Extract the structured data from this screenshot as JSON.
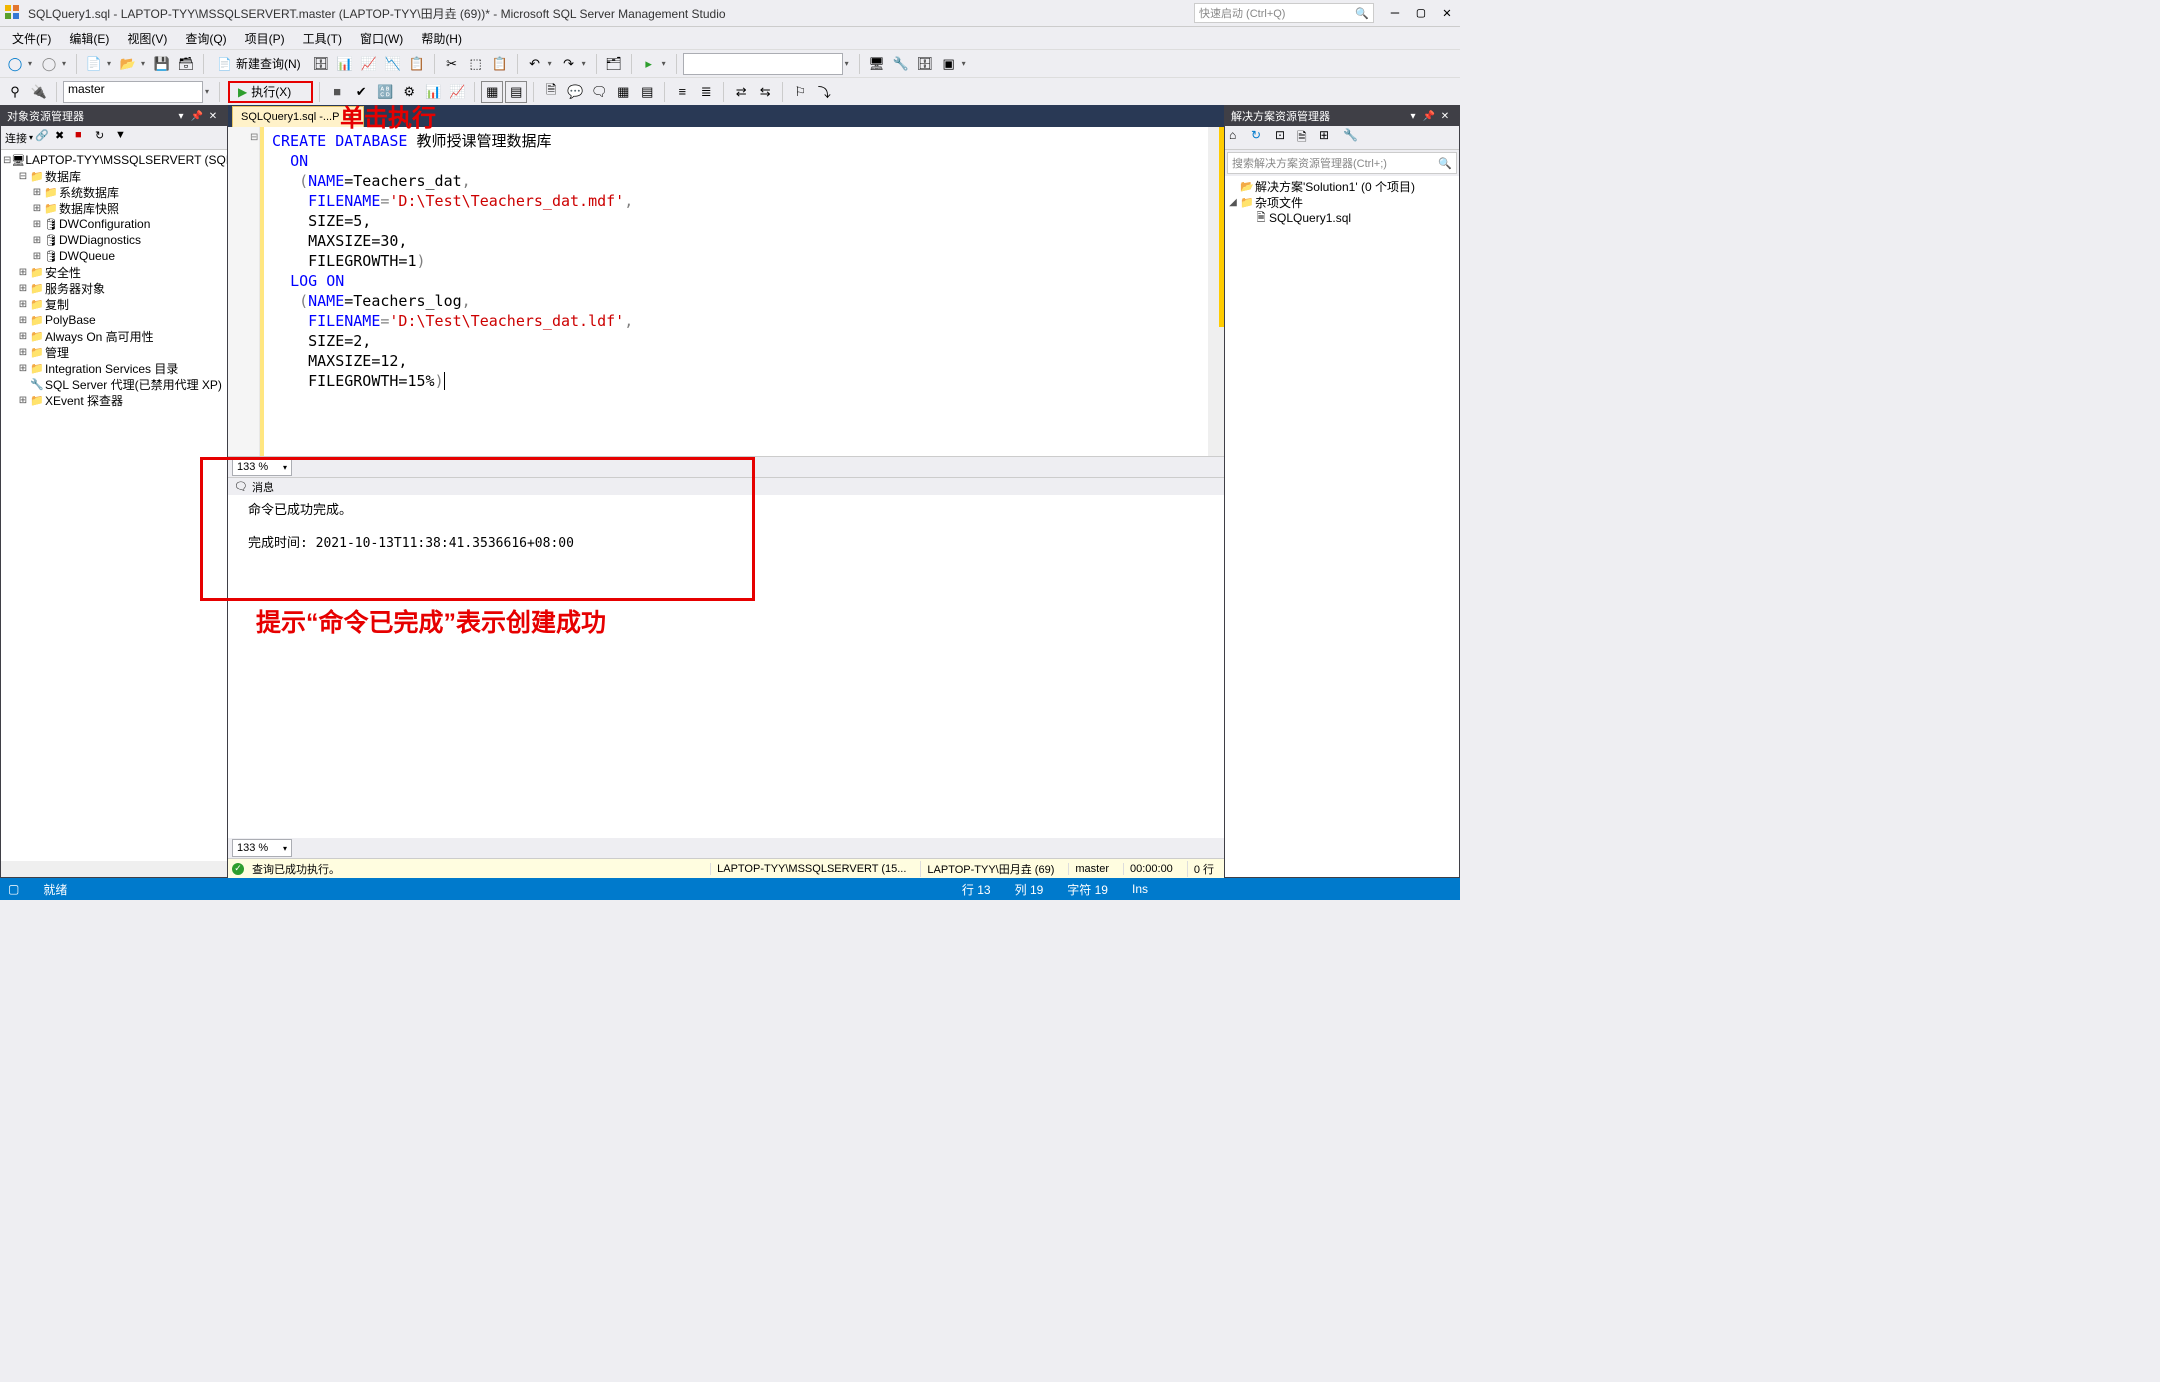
{
  "title": "SQLQuery1.sql - LAPTOP-TYY\\MSSQLSERVERT.master (LAPTOP-TYY\\田月垚 (69))* - Microsoft SQL Server Management Studio",
  "quickLaunch": {
    "placeholder": "快速启动 (Ctrl+Q)"
  },
  "menu": {
    "file": "文件(F)",
    "edit": "编辑(E)",
    "view": "视图(V)",
    "query": "查询(Q)",
    "project": "项目(P)",
    "tools": "工具(T)",
    "window": "窗口(W)",
    "help": "帮助(H)"
  },
  "toolbar1": {
    "newQuery": "新建查询(N)"
  },
  "toolbar2": {
    "dbCombo": "master",
    "execute": "执行(X)"
  },
  "annotations": {
    "clickExecute": "单击执行",
    "successHint": "提示“命令已完成”表示创建成功"
  },
  "objExplorer": {
    "title": "对象资源管理器",
    "connectLabel": "连接",
    "nodes": [
      {
        "depth": 0,
        "exp": "⊟",
        "ico": "🖥",
        "label": "LAPTOP-TYY\\MSSQLSERVERT (SQL"
      },
      {
        "depth": 1,
        "exp": "⊟",
        "ico": "📁",
        "label": "数据库"
      },
      {
        "depth": 2,
        "exp": "⊞",
        "ico": "📁",
        "label": "系统数据库"
      },
      {
        "depth": 2,
        "exp": "⊞",
        "ico": "📁",
        "label": "数据库快照"
      },
      {
        "depth": 2,
        "exp": "⊞",
        "ico": "🛢",
        "label": "DWConfiguration"
      },
      {
        "depth": 2,
        "exp": "⊞",
        "ico": "🛢",
        "label": "DWDiagnostics"
      },
      {
        "depth": 2,
        "exp": "⊞",
        "ico": "🛢",
        "label": "DWQueue"
      },
      {
        "depth": 1,
        "exp": "⊞",
        "ico": "📁",
        "label": "安全性"
      },
      {
        "depth": 1,
        "exp": "⊞",
        "ico": "📁",
        "label": "服务器对象"
      },
      {
        "depth": 1,
        "exp": "⊞",
        "ico": "📁",
        "label": "复制"
      },
      {
        "depth": 1,
        "exp": "⊞",
        "ico": "📁",
        "label": "PolyBase"
      },
      {
        "depth": 1,
        "exp": "⊞",
        "ico": "📁",
        "label": "Always On 高可用性"
      },
      {
        "depth": 1,
        "exp": "⊞",
        "ico": "📁",
        "label": "管理"
      },
      {
        "depth": 1,
        "exp": "⊞",
        "ico": "📁",
        "label": "Integration Services 目录"
      },
      {
        "depth": 1,
        "exp": "",
        "ico": "🔧",
        "label": "SQL Server 代理(已禁用代理 XP)"
      },
      {
        "depth": 1,
        "exp": "⊞",
        "ico": "📁",
        "label": "XEvent 探查器"
      }
    ]
  },
  "docTab": {
    "label": "SQLQuery1.sql -...P"
  },
  "code": {
    "l1a": "CREATE",
    "l1b": "DATABASE",
    "l1c": "教师授课管理数据库",
    "l2a": "ON",
    "l3a": "(",
    "l3b": "NAME",
    "l3c": "=Teachers_dat",
    "l3d": ",",
    "l4a": "FILENAME",
    "l4b": "=",
    "l4c": "'D:\\Test\\Teachers_dat.mdf'",
    "l4d": ",",
    "l5": "SIZE=5,",
    "l6": "MAXSIZE=30,",
    "l7a": "FILEGROWTH=1",
    "l7b": ")",
    "l8a": "LOG",
    "l8b": "ON",
    "l9a": "(",
    "l9b": "NAME",
    "l9c": "=Teachers_log",
    "l9d": ",",
    "l10a": "FILENAME",
    "l10b": "=",
    "l10c": "'D:\\Test\\Teachers_dat.ldf'",
    "l10d": ",",
    "l11": "SIZE=2,",
    "l12": "MAXSIZE=12,",
    "l13a": "FILEGROWTH=15%",
    "l13b": ")"
  },
  "zoom": "133 %",
  "msgTab": "消息",
  "messages": {
    "line1": "命令已成功完成。",
    "line2": "完成时间: 2021-10-13T11:38:41.3536616+08:00"
  },
  "queryStatus": {
    "ok": "查询已成功执行。",
    "server": "LAPTOP-TYY\\MSSQLSERVERT (15...",
    "user": "LAPTOP-TYY\\田月垚 (69)",
    "db": "master",
    "time": "00:00:00",
    "rows": "0 行"
  },
  "solExplorer": {
    "title": "解决方案资源管理器",
    "searchPlaceholder": "搜索解决方案资源管理器(Ctrl+;)",
    "nodes": [
      {
        "depth": 0,
        "exp": "",
        "ico": "📂",
        "label": "解决方案'Solution1' (0 个项目)"
      },
      {
        "depth": 0,
        "exp": "◢",
        "ico": "📁",
        "label": "杂项文件"
      },
      {
        "depth": 1,
        "exp": "",
        "ico": "🗎",
        "label": "SQLQuery1.sql"
      }
    ]
  },
  "statusbar": {
    "ready": "就绪",
    "line": "行 13",
    "col": "列 19",
    "ch": "字符 19",
    "ins": "Ins"
  }
}
